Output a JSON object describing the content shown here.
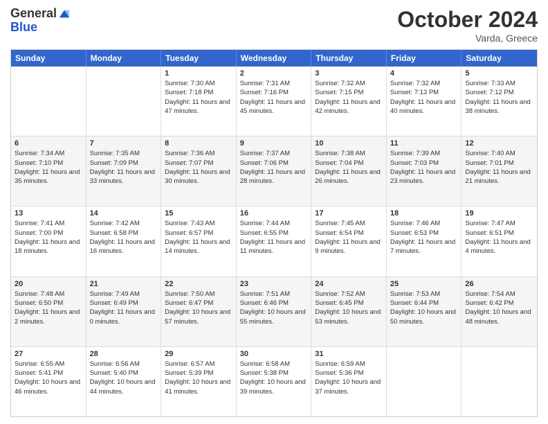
{
  "header": {
    "logo_general": "General",
    "logo_blue": "Blue",
    "month_title": "October 2024",
    "location": "Varda, Greece"
  },
  "calendar": {
    "days_of_week": [
      "Sunday",
      "Monday",
      "Tuesday",
      "Wednesday",
      "Thursday",
      "Friday",
      "Saturday"
    ],
    "rows": [
      [
        {
          "day": "",
          "info": ""
        },
        {
          "day": "",
          "info": ""
        },
        {
          "day": "1",
          "info": "Sunrise: 7:30 AM\nSunset: 7:18 PM\nDaylight: 11 hours and 47 minutes."
        },
        {
          "day": "2",
          "info": "Sunrise: 7:31 AM\nSunset: 7:16 PM\nDaylight: 11 hours and 45 minutes."
        },
        {
          "day": "3",
          "info": "Sunrise: 7:32 AM\nSunset: 7:15 PM\nDaylight: 11 hours and 42 minutes."
        },
        {
          "day": "4",
          "info": "Sunrise: 7:32 AM\nSunset: 7:13 PM\nDaylight: 11 hours and 40 minutes."
        },
        {
          "day": "5",
          "info": "Sunrise: 7:33 AM\nSunset: 7:12 PM\nDaylight: 11 hours and 38 minutes."
        }
      ],
      [
        {
          "day": "6",
          "info": "Sunrise: 7:34 AM\nSunset: 7:10 PM\nDaylight: 11 hours and 35 minutes."
        },
        {
          "day": "7",
          "info": "Sunrise: 7:35 AM\nSunset: 7:09 PM\nDaylight: 11 hours and 33 minutes."
        },
        {
          "day": "8",
          "info": "Sunrise: 7:36 AM\nSunset: 7:07 PM\nDaylight: 11 hours and 30 minutes."
        },
        {
          "day": "9",
          "info": "Sunrise: 7:37 AM\nSunset: 7:06 PM\nDaylight: 11 hours and 28 minutes."
        },
        {
          "day": "10",
          "info": "Sunrise: 7:38 AM\nSunset: 7:04 PM\nDaylight: 11 hours and 26 minutes."
        },
        {
          "day": "11",
          "info": "Sunrise: 7:39 AM\nSunset: 7:03 PM\nDaylight: 11 hours and 23 minutes."
        },
        {
          "day": "12",
          "info": "Sunrise: 7:40 AM\nSunset: 7:01 PM\nDaylight: 11 hours and 21 minutes."
        }
      ],
      [
        {
          "day": "13",
          "info": "Sunrise: 7:41 AM\nSunset: 7:00 PM\nDaylight: 11 hours and 18 minutes."
        },
        {
          "day": "14",
          "info": "Sunrise: 7:42 AM\nSunset: 6:58 PM\nDaylight: 11 hours and 16 minutes."
        },
        {
          "day": "15",
          "info": "Sunrise: 7:43 AM\nSunset: 6:57 PM\nDaylight: 11 hours and 14 minutes."
        },
        {
          "day": "16",
          "info": "Sunrise: 7:44 AM\nSunset: 6:55 PM\nDaylight: 11 hours and 11 minutes."
        },
        {
          "day": "17",
          "info": "Sunrise: 7:45 AM\nSunset: 6:54 PM\nDaylight: 11 hours and 9 minutes."
        },
        {
          "day": "18",
          "info": "Sunrise: 7:46 AM\nSunset: 6:53 PM\nDaylight: 11 hours and 7 minutes."
        },
        {
          "day": "19",
          "info": "Sunrise: 7:47 AM\nSunset: 6:51 PM\nDaylight: 11 hours and 4 minutes."
        }
      ],
      [
        {
          "day": "20",
          "info": "Sunrise: 7:48 AM\nSunset: 6:50 PM\nDaylight: 11 hours and 2 minutes."
        },
        {
          "day": "21",
          "info": "Sunrise: 7:49 AM\nSunset: 6:49 PM\nDaylight: 11 hours and 0 minutes."
        },
        {
          "day": "22",
          "info": "Sunrise: 7:50 AM\nSunset: 6:47 PM\nDaylight: 10 hours and 57 minutes."
        },
        {
          "day": "23",
          "info": "Sunrise: 7:51 AM\nSunset: 6:46 PM\nDaylight: 10 hours and 55 minutes."
        },
        {
          "day": "24",
          "info": "Sunrise: 7:52 AM\nSunset: 6:45 PM\nDaylight: 10 hours and 53 minutes."
        },
        {
          "day": "25",
          "info": "Sunrise: 7:53 AM\nSunset: 6:44 PM\nDaylight: 10 hours and 50 minutes."
        },
        {
          "day": "26",
          "info": "Sunrise: 7:54 AM\nSunset: 6:42 PM\nDaylight: 10 hours and 48 minutes."
        }
      ],
      [
        {
          "day": "27",
          "info": "Sunrise: 6:55 AM\nSunset: 5:41 PM\nDaylight: 10 hours and 46 minutes."
        },
        {
          "day": "28",
          "info": "Sunrise: 6:56 AM\nSunset: 5:40 PM\nDaylight: 10 hours and 44 minutes."
        },
        {
          "day": "29",
          "info": "Sunrise: 6:57 AM\nSunset: 5:39 PM\nDaylight: 10 hours and 41 minutes."
        },
        {
          "day": "30",
          "info": "Sunrise: 6:58 AM\nSunset: 5:38 PM\nDaylight: 10 hours and 39 minutes."
        },
        {
          "day": "31",
          "info": "Sunrise: 6:59 AM\nSunset: 5:36 PM\nDaylight: 10 hours and 37 minutes."
        },
        {
          "day": "",
          "info": ""
        },
        {
          "day": "",
          "info": ""
        }
      ]
    ]
  }
}
